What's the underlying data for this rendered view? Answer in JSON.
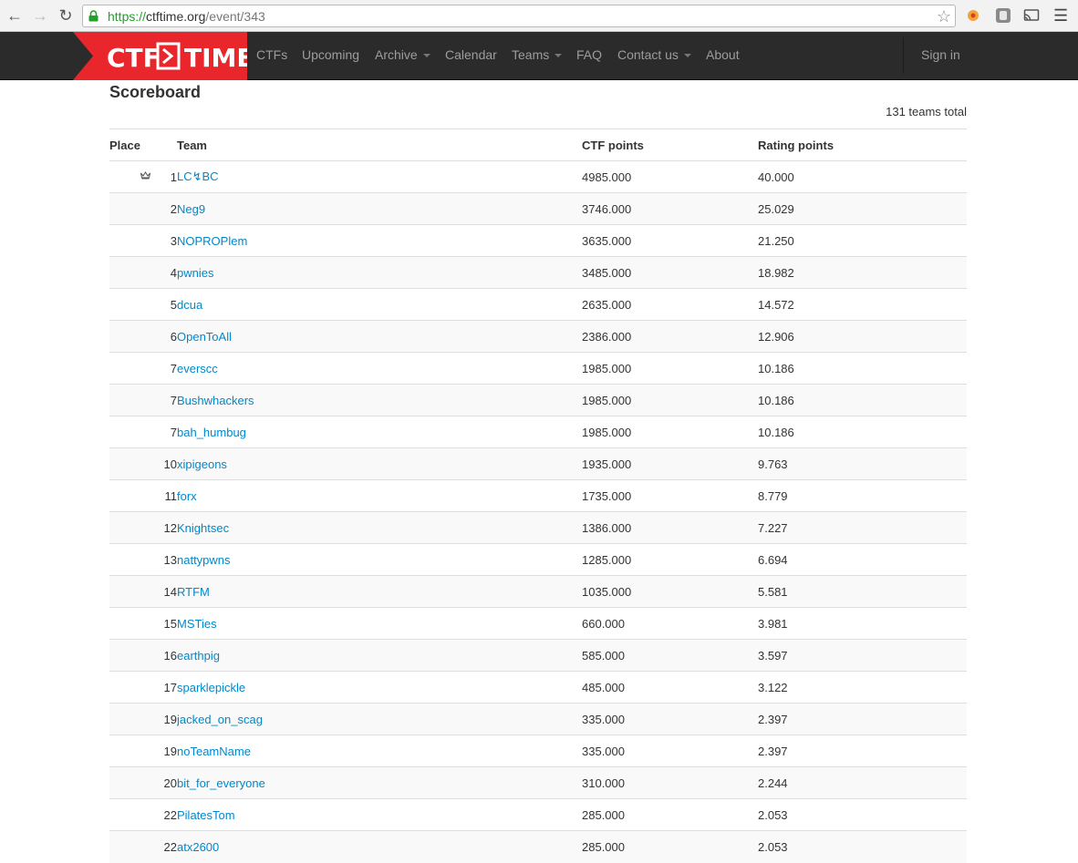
{
  "browser": {
    "url_scheme": "https://",
    "url_host": "ctftime.org",
    "url_path": "/event/343"
  },
  "site": {
    "logo_left": "CTF",
    "logo_right": "TIME",
    "nav": [
      {
        "label": "CTFs",
        "dropdown": false
      },
      {
        "label": "Upcoming",
        "dropdown": false
      },
      {
        "label": "Archive",
        "dropdown": true
      },
      {
        "label": "Calendar",
        "dropdown": false
      },
      {
        "label": "Teams",
        "dropdown": true
      },
      {
        "label": "FAQ",
        "dropdown": false
      },
      {
        "label": "Contact us",
        "dropdown": true
      },
      {
        "label": "About",
        "dropdown": false
      }
    ],
    "sign_in": "Sign in",
    "colors": {
      "navbar": "#2b2b2b",
      "logo_red": "#e8262b",
      "link": "#0088cc"
    }
  },
  "scoreboard": {
    "title": "Scoreboard",
    "teams_total": "131 teams total",
    "columns": {
      "place": "Place",
      "team": "Team",
      "ctf_points": "CTF points",
      "rating_points": "Rating points"
    },
    "rows": [
      {
        "place": "1",
        "team": "LC↯BC",
        "ctf": "4985.000",
        "rating": "40.000",
        "crown": true
      },
      {
        "place": "2",
        "team": "Neg9",
        "ctf": "3746.000",
        "rating": "25.029"
      },
      {
        "place": "3",
        "team": "NOPROPlem",
        "ctf": "3635.000",
        "rating": "21.250"
      },
      {
        "place": "4",
        "team": "pwnies",
        "ctf": "3485.000",
        "rating": "18.982"
      },
      {
        "place": "5",
        "team": "dcua",
        "ctf": "2635.000",
        "rating": "14.572"
      },
      {
        "place": "6",
        "team": "OpenToAll",
        "ctf": "2386.000",
        "rating": "12.906"
      },
      {
        "place": "7",
        "team": "everscc",
        "ctf": "1985.000",
        "rating": "10.186"
      },
      {
        "place": "7",
        "team": "Bushwhackers",
        "ctf": "1985.000",
        "rating": "10.186"
      },
      {
        "place": "7",
        "team": "bah_humbug",
        "ctf": "1985.000",
        "rating": "10.186"
      },
      {
        "place": "10",
        "team": "xipigeons",
        "ctf": "1935.000",
        "rating": "9.763"
      },
      {
        "place": "11",
        "team": "forx",
        "ctf": "1735.000",
        "rating": "8.779"
      },
      {
        "place": "12",
        "team": "Knightsec",
        "ctf": "1386.000",
        "rating": "7.227"
      },
      {
        "place": "13",
        "team": "nattypwns",
        "ctf": "1285.000",
        "rating": "6.694"
      },
      {
        "place": "14",
        "team": "RTFM",
        "ctf": "1035.000",
        "rating": "5.581"
      },
      {
        "place": "15",
        "team": "MSTies",
        "ctf": "660.000",
        "rating": "3.981"
      },
      {
        "place": "16",
        "team": "earthpig",
        "ctf": "585.000",
        "rating": "3.597"
      },
      {
        "place": "17",
        "team": "sparklepickle",
        "ctf": "485.000",
        "rating": "3.122"
      },
      {
        "place": "19",
        "team": "jacked_on_scag",
        "ctf": "335.000",
        "rating": "2.397"
      },
      {
        "place": "19",
        "team": "noTeamName",
        "ctf": "335.000",
        "rating": "2.397"
      },
      {
        "place": "20",
        "team": "bit_for_everyone",
        "ctf": "310.000",
        "rating": "2.244"
      },
      {
        "place": "22",
        "team": "PilatesTom",
        "ctf": "285.000",
        "rating": "2.053"
      },
      {
        "place": "22",
        "team": "atx2600",
        "ctf": "285.000",
        "rating": "2.053"
      }
    ]
  }
}
